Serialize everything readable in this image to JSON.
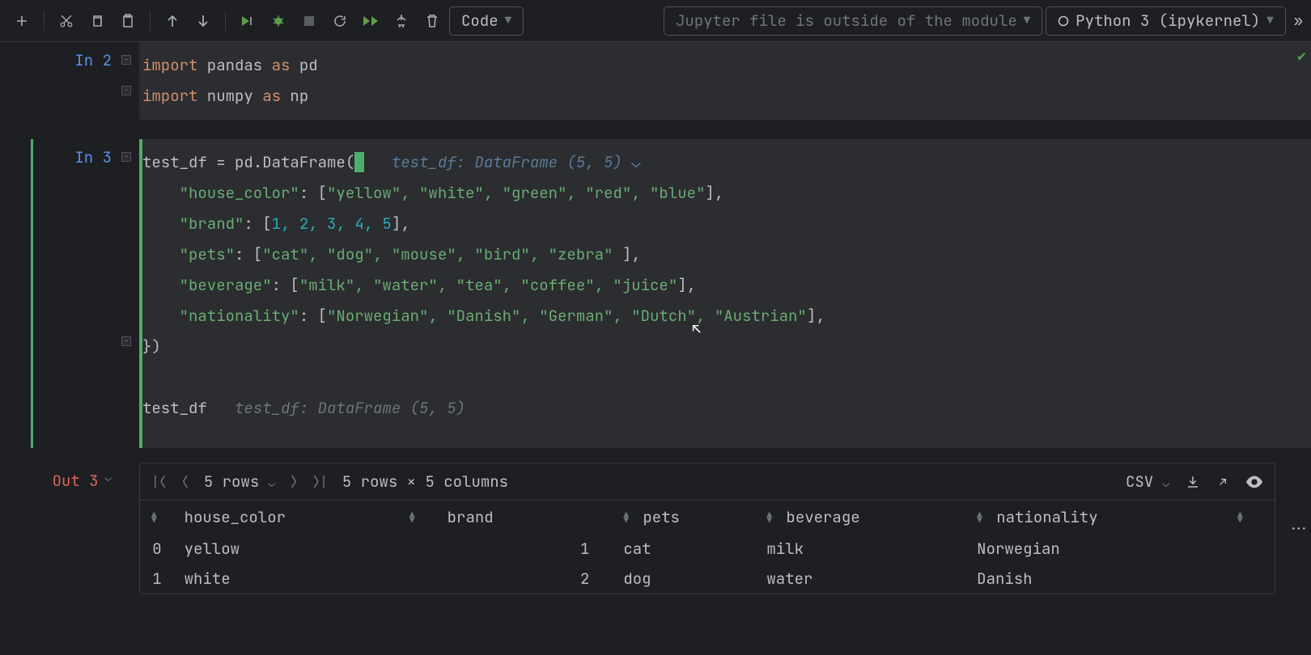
{
  "toolbar": {
    "cell_type": "Code",
    "module_status": "Jupyter file is outside of the module",
    "kernel": "Python 3 (ipykernel)"
  },
  "cells": {
    "in2": {
      "prompt": "In 2",
      "line1_kw1": "import",
      "line1_mod": " pandas ",
      "line1_kw2": "as",
      "line1_alias": " pd",
      "line2_kw1": "import",
      "line2_mod": " numpy ",
      "line2_kw2": "as",
      "line2_alias": " np"
    },
    "in3": {
      "prompt": "In 3",
      "assign_var": "test_df ",
      "assign_eq": "= ",
      "assign_call": "pd.DataFrame(",
      "brace": "{",
      "hint": "   test_df: DataFrame (5, 5)",
      "l2_key": "\"house_color\"",
      "l2_vals": "\"yellow\", \"white\", \"green\", \"red\", \"blue\"",
      "l3_key": "\"brand\"",
      "l3_vals_nums": "1, 2, 3, 4, 5",
      "l4_key": "\"pets\"",
      "l4_vals": "\"cat\", \"dog\", \"mouse\", \"bird\", \"zebra\" ",
      "l5_key": "\"beverage\"",
      "l5_vals": "\"milk\", \"water\", \"tea\", \"coffee\", \"juice\"",
      "l6_key": "\"nationality\"",
      "l6_vals": "\"Norwegian\", \"Danish\", \"German\", \"Dutch\", \"Austrian\"",
      "close": "})",
      "last_var": "test_df",
      "last_hint": "   test_df: DataFrame (5, 5)"
    }
  },
  "out3": {
    "prompt": "Out 3",
    "rows_label": "5 rows",
    "shape_label": "5 rows × 5 columns",
    "csv": "CSV",
    "headers": {
      "c1": "house_color",
      "c2": "brand",
      "c3": "pets",
      "c4": "beverage",
      "c5": "nationality"
    },
    "rows": [
      {
        "idx": "0",
        "house_color": "yellow",
        "brand": "1",
        "pets": "cat",
        "beverage": "milk",
        "nationality": "Norwegian"
      },
      {
        "idx": "1",
        "house_color": "white",
        "brand": "2",
        "pets": "dog",
        "beverage": "water",
        "nationality": "Danish"
      }
    ]
  }
}
